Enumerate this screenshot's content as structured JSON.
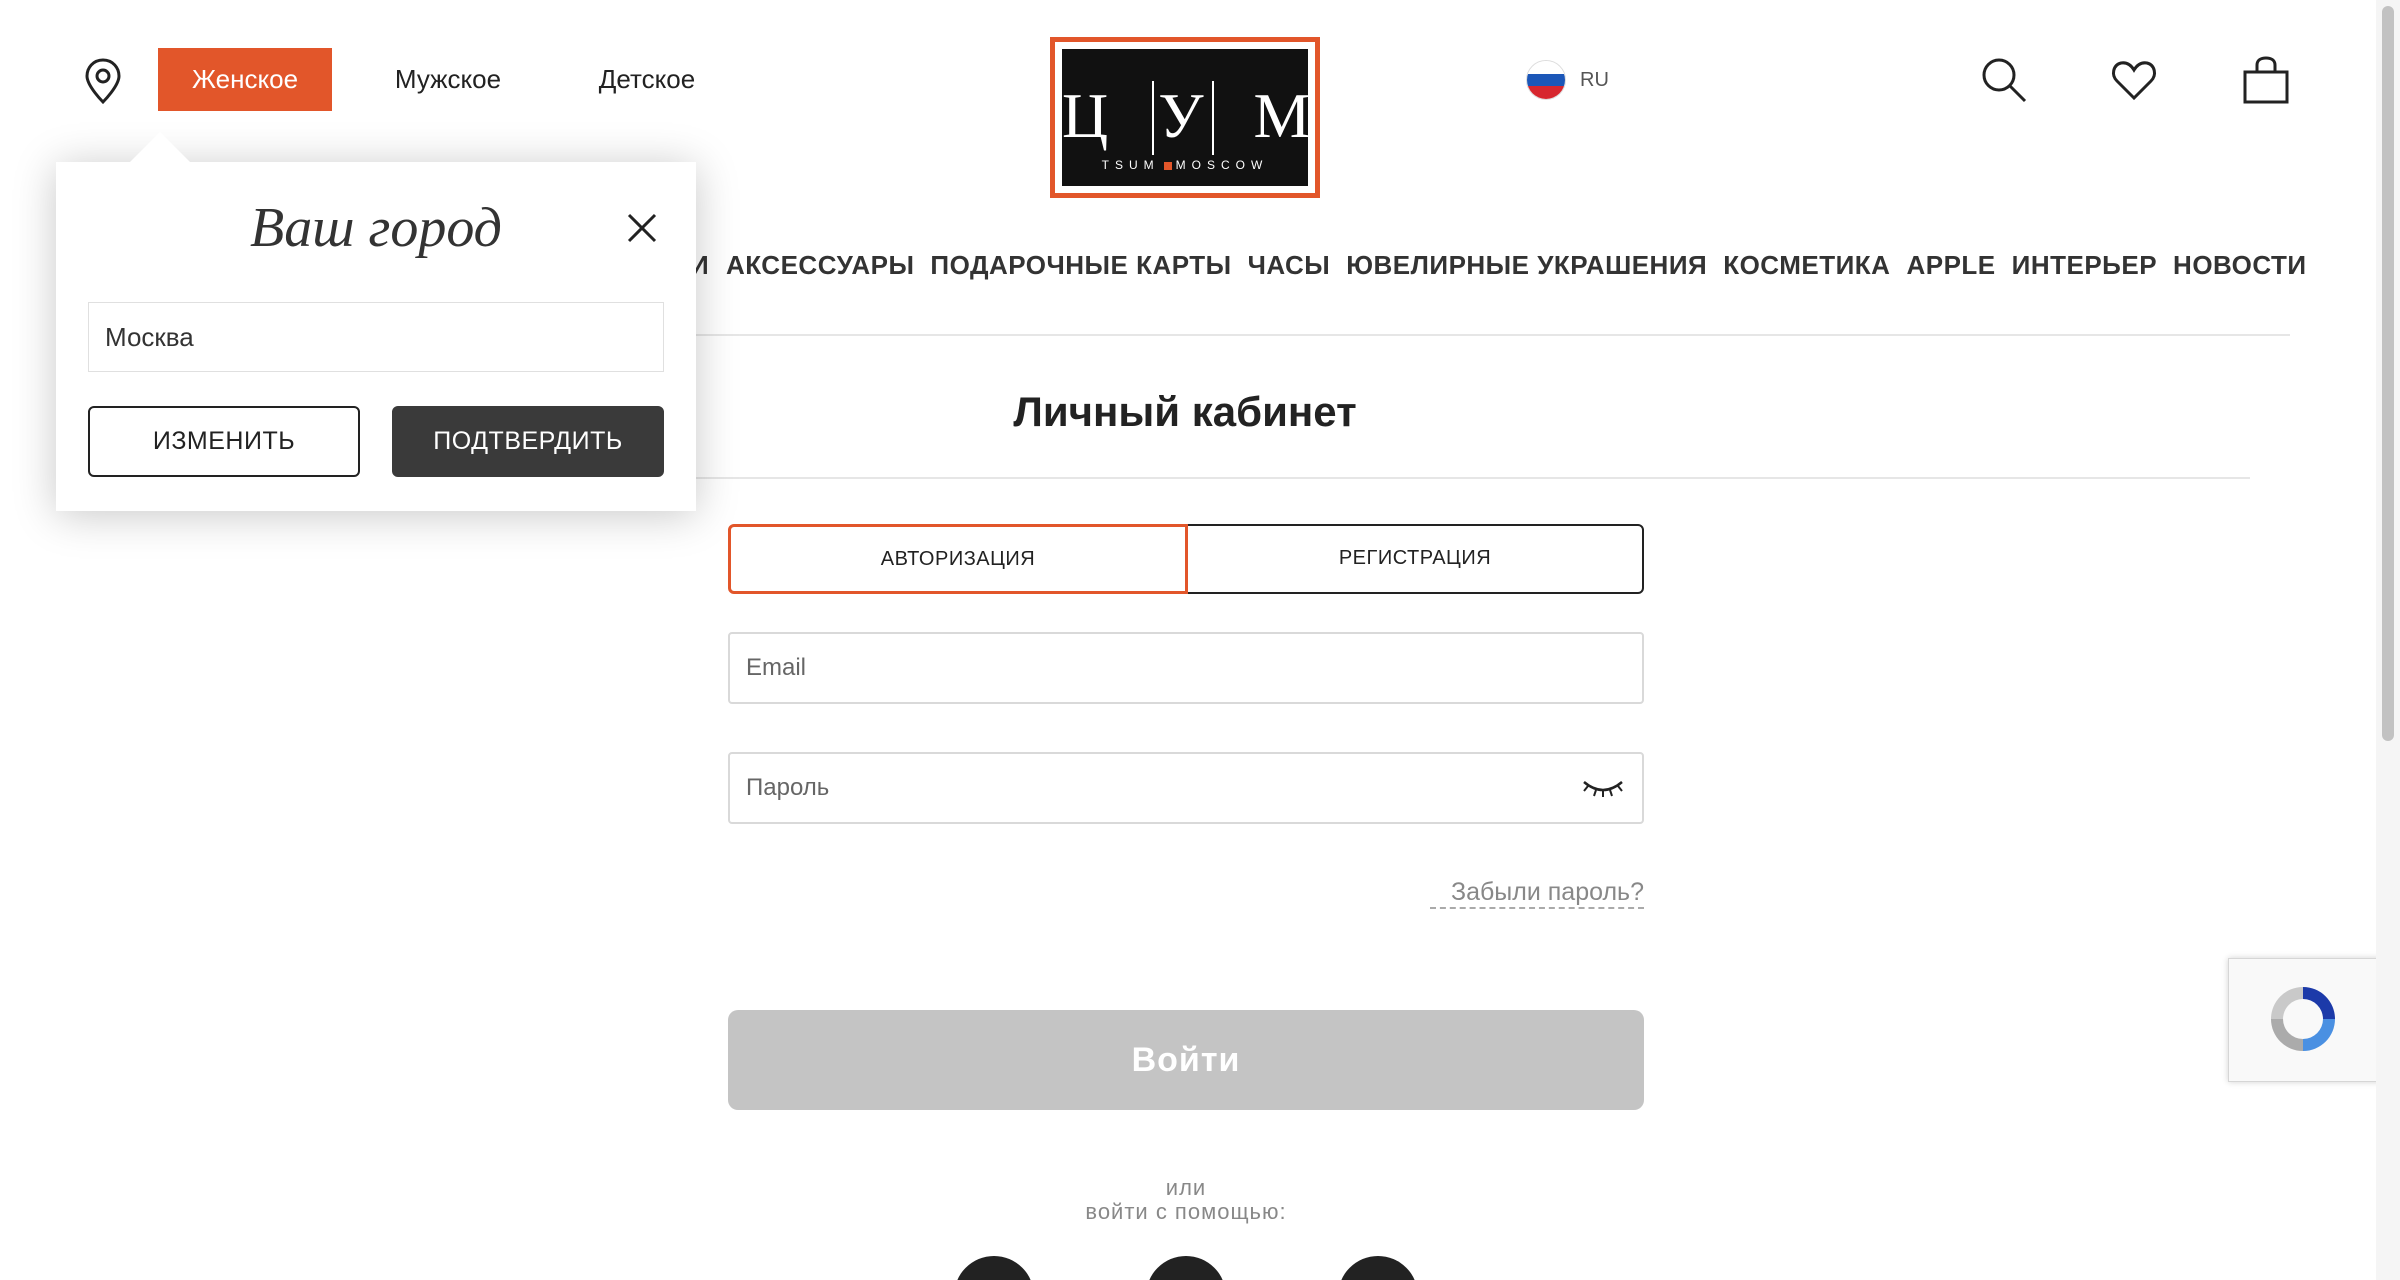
{
  "header": {
    "gender_tabs": [
      {
        "label": "Женское",
        "active": true
      },
      {
        "label": "Мужское",
        "active": false
      },
      {
        "label": "Детское",
        "active": false
      }
    ],
    "logo": {
      "letters": "Ц|У|М",
      "sub_left": "TSUM",
      "sub_right": "MOSCOW"
    },
    "language": {
      "label": "RU",
      "flag_colors": [
        "#ffffff",
        "#1c57b8",
        "#d7262e"
      ]
    },
    "icons": [
      "location-pin-icon",
      "search-icon",
      "heart-icon",
      "bag-icon"
    ]
  },
  "nav": {
    "items": [
      "И",
      "АКСЕССУАРЫ",
      "ПОДАРОЧНЫЕ КАРТЫ",
      "ЧАСЫ",
      "ЮВЕЛИРНЫЕ УКРАШЕНИЯ",
      "КОСМЕТИКА",
      "APPLE",
      "ИНТЕРЬЕР",
      "НОВОСТИ"
    ]
  },
  "main": {
    "title": "Личный кабинет",
    "tabs": [
      {
        "label": "АВТОРИЗАЦИЯ",
        "active": true
      },
      {
        "label": "РЕГИСТРАЦИЯ",
        "active": false
      }
    ],
    "email_placeholder": "Email",
    "password_placeholder": "Пароль",
    "forgot_link": "Забыли пароль?",
    "login_button": "Войти",
    "or_line1": "или",
    "or_line2": "войти с помощью:"
  },
  "city_popup": {
    "title": "Ваш город",
    "city_value": "Москва",
    "change_button": "ИЗМЕНИТЬ",
    "confirm_button": "ПОДТВЕРДИТЬ"
  },
  "colors": {
    "accent": "#e2562a",
    "dark_button": "#3a3a3a",
    "disabled_button": "#c4c4c4"
  }
}
